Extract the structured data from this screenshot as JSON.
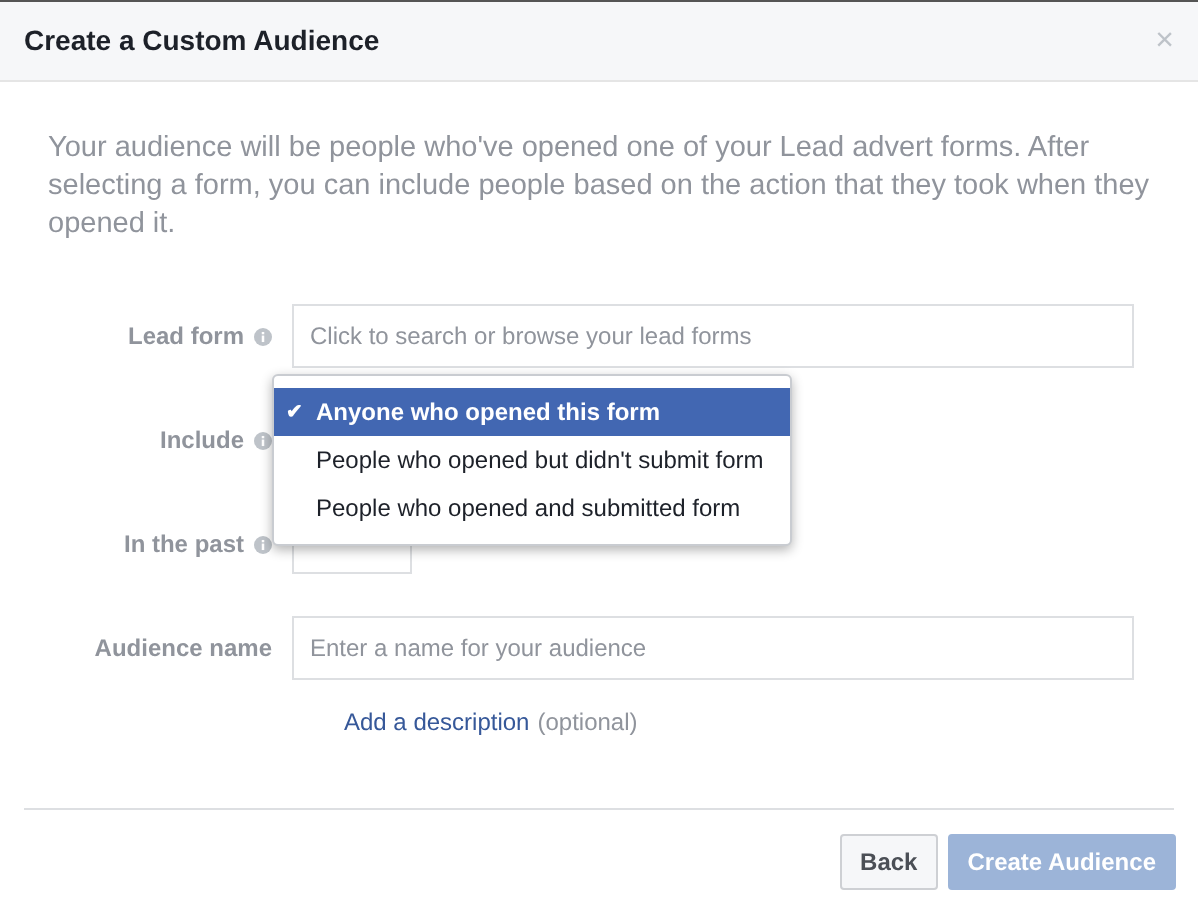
{
  "dialog": {
    "title": "Create a Custom Audience",
    "close": "×"
  },
  "intro": "Your audience will be people who've opened one of your Lead advert forms. After selecting a form, you can include people based on the action that they took when they opened it.",
  "fields": [
    {
      "label": "Lead form",
      "info": true,
      "kind": "text",
      "placeholder": "Click to search or browse your lead forms"
    },
    {
      "label": "Include",
      "info": true,
      "kind": "dropdown",
      "check": "✔",
      "options": [
        {
          "label": "Anyone who opened this form",
          "selected": true
        },
        {
          "label": "People who opened but didn't submit form",
          "selected": false
        },
        {
          "label": "People who opened and submitted form",
          "selected": false
        }
      ]
    },
    {
      "label": "In the past",
      "info": true,
      "kind": "small-select"
    },
    {
      "label": "Audience name",
      "info": false,
      "kind": "text",
      "placeholder": "Enter a name for your audience"
    }
  ],
  "description_link": {
    "link": "Add a description",
    "note": "(optional)"
  },
  "buttons": [
    {
      "label": "Back",
      "primary": false,
      "disabled": false
    },
    {
      "label": "Create Audience",
      "primary": true,
      "disabled": true
    }
  ]
}
